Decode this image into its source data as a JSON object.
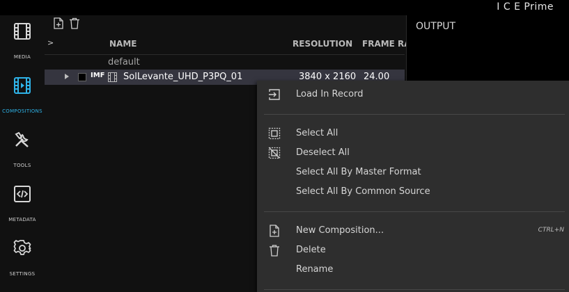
{
  "app": {
    "title": "I C E Prime"
  },
  "sidebar": {
    "items": [
      {
        "label": "MEDIA",
        "icon": "film-icon",
        "active": false
      },
      {
        "label": "COMPOSITIONS",
        "icon": "composition-film-icon",
        "active": true
      },
      {
        "label": "TOOLS",
        "icon": "tools-icon",
        "active": false
      },
      {
        "label": "METADATA",
        "icon": "code-file-icon",
        "active": false
      },
      {
        "label": "SETTINGS",
        "icon": "gear-icon",
        "active": false
      }
    ]
  },
  "toolbar": {
    "new_icon": "new-file-icon",
    "delete_icon": "trash-icon"
  },
  "table": {
    "expand_symbol": ">",
    "headers": {
      "name": "NAME",
      "resolution": "RESOLUTION",
      "frame_rate": "FRAME RA"
    },
    "group": "default",
    "rows": [
      {
        "type": "IMF",
        "name": "SolLevante_UHD_P3PQ_01",
        "resolution": "3840 x 2160",
        "frame_rate": "24.00"
      }
    ]
  },
  "output": {
    "title": "OUTPUT"
  },
  "context_menu": {
    "items": [
      {
        "label": "Load In Record",
        "icon": "load-record-icon"
      },
      {
        "label": "Select All",
        "icon": "select-all-icon"
      },
      {
        "label": "Deselect All",
        "icon": "deselect-all-icon"
      },
      {
        "label": "Select All By Master Format"
      },
      {
        "label": "Select All By Common Source"
      },
      {
        "label": "New Composition...",
        "icon": "new-file-icon",
        "shortcut": "CTRL+N"
      },
      {
        "label": "Delete",
        "icon": "trash-icon"
      },
      {
        "label": "Rename"
      }
    ]
  },
  "colors": {
    "accent": "#2fb3e8",
    "menu_bg": "#2e2e2e",
    "row_selected": "#35353f"
  }
}
